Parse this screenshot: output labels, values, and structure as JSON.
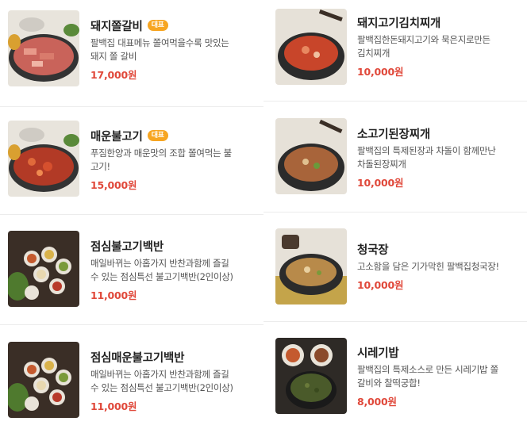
{
  "left_items": [
    {
      "name": "돼지쫄갈비",
      "badge": "대표",
      "desc": "팔백집 대표메뉴 쫄여먹을수록 맛있는\n돼지 쫄 갈비",
      "price": "17,000원",
      "image": "grilled-pork-rib-pan-photo"
    },
    {
      "name": "매운불고기",
      "badge": "대표",
      "desc": "푸짐한양과 매운맛의 조합 쫄여먹는 불\n고기!",
      "price": "15,000원",
      "image": "spicy-bulgogi-pan-photo"
    },
    {
      "name": "점심불고기백반",
      "badge": "",
      "desc": "매일바뀌는 아홉가지 반찬과함께 즐길\n수 있는 점심특선 불고기백반(2인이상)",
      "price": "11,000원",
      "image": "lunch-set-side-dishes-photo"
    },
    {
      "name": "점심매운불고기백반",
      "badge": "",
      "desc": "매일바뀌는 아홉가지 반찬과함께 즐길\n수 있는 점심특선 불고기백반(2인이상)",
      "price": "11,000원",
      "image": "lunch-set-side-dishes-photo"
    }
  ],
  "right_items": [
    {
      "name": "돼지고기김치찌개",
      "badge": "",
      "desc": "팔백집한돈돼지고기와 묵은지로만든\n김치찌개",
      "price": "10,000원",
      "image": "kimchi-stew-pot-photo"
    },
    {
      "name": "소고기된장찌개",
      "badge": "",
      "desc": "팔백집의 특제된장과 차돌이 함께만난\n차돌된장찌개",
      "price": "10,000원",
      "image": "soybean-stew-pot-photo"
    },
    {
      "name": "청국장",
      "badge": "",
      "desc": "고소함을 담은 기가막힌 팔백집청국장!",
      "price": "10,000원",
      "image": "cheonggukjang-pot-photo"
    },
    {
      "name": "시레기밥",
      "badge": "",
      "desc": "팔백집의 특제소스로 만든 시레기밥 쫄\n갈비와 찰떡궁합!",
      "price": "8,000원",
      "image": "siraegi-rice-photo"
    }
  ]
}
